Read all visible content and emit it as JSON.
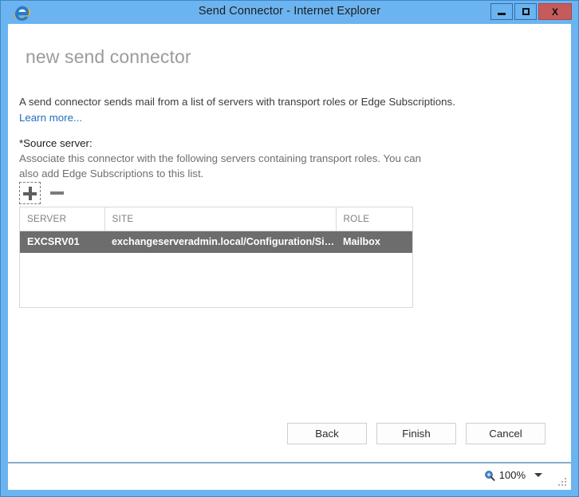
{
  "window": {
    "title": "Send Connector - Internet Explorer",
    "logo_icon": "internet-explorer-icon",
    "controls": {
      "minimize": "minimize-icon",
      "maximize": "maximize-icon",
      "close": "X"
    }
  },
  "page": {
    "heading": "new send connector",
    "intro": "A send connector sends mail from a list of servers with transport roles or Edge Subscriptions.",
    "learn_more": "Learn more...",
    "field_label": "*Source server:",
    "field_description": "Associate this connector with the following servers containing transport roles. You can also add Edge Subscriptions to this list."
  },
  "toolbar": {
    "add_icon": "plus-icon",
    "remove_icon": "minus-icon"
  },
  "table": {
    "columns": [
      "SERVER",
      "SITE",
      "ROLE"
    ],
    "rows": [
      {
        "server": "EXCSRV01",
        "site": "exchangeserveradmin.local/Configuration/Sites/...",
        "role": "Mailbox",
        "selected": true
      }
    ]
  },
  "buttons": {
    "back": "Back",
    "finish": "Finish",
    "cancel": "Cancel"
  },
  "statusbar": {
    "zoom_icon": "zoom-magnifier-icon",
    "zoom_level": "100%",
    "caret_icon": "chevron-down-icon",
    "grip_icon": "resize-grip-icon"
  },
  "colors": {
    "titlebar": "#6cb4f0",
    "close_button": "#c75b5b",
    "link": "#1e6fba",
    "selected_row": "#6d6d6d",
    "heading_text": "#9b9b9b"
  }
}
